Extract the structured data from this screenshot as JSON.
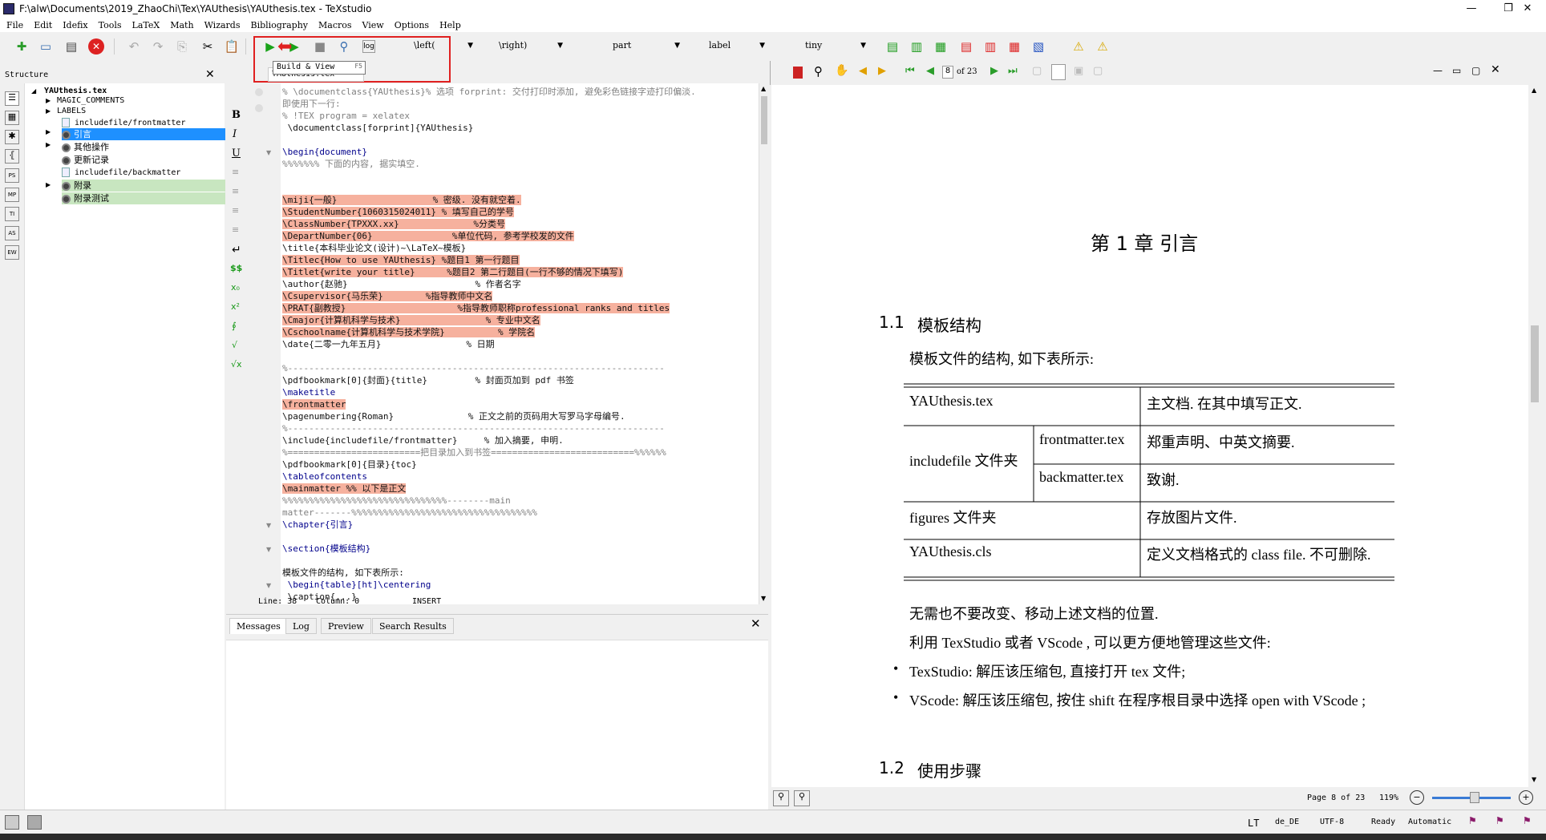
{
  "window": {
    "title": "F:\\alw\\Documents\\2019_ZhaoChi\\Tex\\YAUthesis\\YAUthesis.tex - TeXstudio",
    "controls": [
      "—",
      "❐",
      "✕"
    ]
  },
  "menu": [
    "File",
    "Edit",
    "Idefix",
    "Tools",
    "LaTeX",
    "Math",
    "Wizards",
    "Bibliography",
    "Macros",
    "View",
    "Options",
    "Help"
  ],
  "toolbar": {
    "left_combo": "\\left(",
    "right_combo": "\\right)",
    "part_combo": "part",
    "label_combo": "label",
    "size_combo": "tiny",
    "tooltip": "Build & View",
    "tooltip_shortcut": "F5",
    "arrow_marker": "⬅"
  },
  "structure": {
    "title": "Structure",
    "close": "✕",
    "side_icons": [
      "☰",
      "▦",
      "✱",
      "⦃",
      "PS",
      "MP",
      "TI",
      "AS",
      "EW"
    ],
    "items": [
      {
        "label": "YAUthesis.tex"
      },
      {
        "label": "MAGIC_COMMENTS"
      },
      {
        "label": "LABELS"
      },
      {
        "label": "includefile/frontmatter"
      },
      {
        "label": "引言"
      },
      {
        "label": "其他操作"
      },
      {
        "label": "更新记录"
      },
      {
        "label": "includefile/backmatter"
      },
      {
        "label": "附录"
      },
      {
        "label": "附录测试"
      }
    ]
  },
  "editor": {
    "tab": "YAUthesis.tex",
    "side_icons": [
      "B",
      "I",
      "U",
      "≡",
      "≡",
      "≡",
      "≡",
      "↵",
      "$$",
      "x₀",
      "x²",
      "∮",
      "√",
      "√x"
    ],
    "lines": [
      "% \\documentclass{YAUthesis}% 选项 forprint: 交付打印时添加, 避免彩色链接字迹打印偏淡.",
      "即使用下一行:",
      "% !TEX program = xelatex",
      " \\documentclass[forprint]{YAUthesis}",
      "",
      "\\begin{document}",
      "%%%%%%% 下面的内容, 据实填空.",
      "",
      "",
      "",
      "\\miji{一般}                  % 密级. 没有就空着.",
      "\\StudentNumber{1060315024011} % 填写自己的学号",
      "\\ClassNumber{TPXXX.xx}              %分类号",
      "\\DepartNumber{06}               %单位代码, 参考学校发的文件",
      "\\title{本科毕业论文(设计)~\\LaTeX~模板}",
      "\\Titlec{How to use YAUthesis} %题目1 第一行题目",
      "\\Titlet{write your title}      %题目2 第二行题目(一行不够的情况下填写)",
      "\\author{赵驰}                        % 作者名字",
      "\\Csupervisor{马乐荣}        %指导教师中文名",
      "\\PRAT{副教授}                     %指导教师职称professional ranks and titles",
      "\\Cmajor{计算机科学与技术}                % 专业中文名",
      "\\Cschoolname{计算机科学与技术学院}          % 学院名",
      "\\date{二零一九年五月}                % 日期",
      "",
      "%-----------------------------------------------------------------------",
      "\\pdfbookmark[0]{封面}{title}         % 封面页加到 pdf 书签",
      "\\maketitle",
      "\\frontmatter",
      "\\pagenumbering{Roman}              % 正文之前的页码用大写罗马字母编号.",
      "%-----------------------------------------------------------------------",
      "\\include{includefile/frontmatter}     % 加入摘要, 申明.",
      "%=========================把目录加入到书签===========================%%%%%%",
      "\\pdfbookmark[0]{目录}{toc}",
      "\\tableofcontents",
      "\\mainmatter %% 以下是正文",
      "%%%%%%%%%%%%%%%%%%%%%%%%%%%%%%%--------main",
      "matter-------%%%%%%%%%%%%%%%%%%%%%%%%%%%%%%%%%%%",
      "\\chapter{引言}",
      "",
      "\\section{模板结构}",
      "",
      "模板文件的结构, 如下表所示:",
      " \\begin{table}[ht]\\centering",
      " \\caption{...}"
    ],
    "status": {
      "line": "Line: 38",
      "column": "Column: 0",
      "mode": "INSERT"
    }
  },
  "messages": {
    "tabs": [
      "Messages",
      "Log",
      "Preview",
      "Search Results"
    ],
    "close": "✕"
  },
  "pdf": {
    "page_input": "8",
    "of_pages": "of 23",
    "chapter": "第 1 章   引言",
    "section1_num": "1.1",
    "section1_title": "模板结构",
    "intro": "模板文件的结构, 如下表所示:",
    "table": {
      "r1c1": "YAUthesis.tex",
      "r1c3": "主文档. 在其中填写正文.",
      "r2c1": "includefile 文件夹",
      "r2c2": "frontmatter.tex",
      "r2c3": "郑重声明、中英文摘要.",
      "r3c2": "backmatter.tex",
      "r3c3": "致谢.",
      "r4c1": "figures 文件夹",
      "r4c3": "存放图片文件.",
      "r5c1": "YAUthesis.cls",
      "r5c3": "定义文档格式的 class file. 不可删除."
    },
    "p1": "无需也不要改变、移动上述文档的位置.",
    "p2": "利用 TexStudio 或者 VScode , 可以更方便地管理这些文件:",
    "bullet1": "TexStudio: 解压该压缩包, 直接打开 tex 文件;",
    "bullet2": "VScode: 解压该压缩包, 按住 shift 在程序根目录中选择 open with VScode ;",
    "section2_num": "1.2",
    "section2_title": "使用步骤",
    "page_status": "Page 8 of 23",
    "zoom": "119%",
    "zoom_level": 0.55
  },
  "statusbar": {
    "lt": "LT",
    "lang": "de_DE",
    "encoding": "UTF-8",
    "state": "Ready",
    "mode": "Automatic"
  },
  "colors": {
    "highlight": "#f6b19e",
    "selection": "#1e90ff",
    "green_selection": "#c8e6c0",
    "red_box": "#e02020"
  }
}
